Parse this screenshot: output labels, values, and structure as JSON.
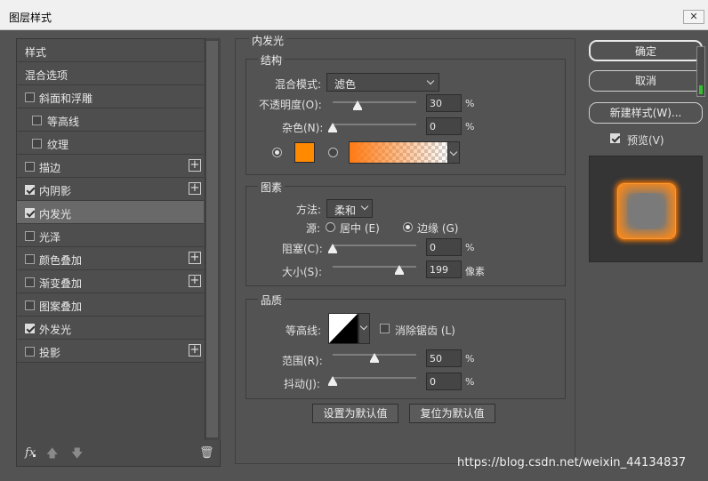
{
  "window": {
    "title": "图层样式",
    "close_glyph": "✕"
  },
  "left_list": {
    "items": [
      {
        "label": "样式",
        "checkbox": false,
        "checked": false,
        "plus": false,
        "selected": false
      },
      {
        "label": "混合选项",
        "checkbox": false,
        "checked": false,
        "plus": false,
        "selected": false
      },
      {
        "label": "斜面和浮雕",
        "checkbox": true,
        "checked": false,
        "plus": false,
        "selected": false
      },
      {
        "label": "等高线",
        "checkbox": true,
        "checked": false,
        "plus": false,
        "selected": false,
        "indent": true
      },
      {
        "label": "纹理",
        "checkbox": true,
        "checked": false,
        "plus": false,
        "selected": false,
        "indent": true
      },
      {
        "label": "描边",
        "checkbox": true,
        "checked": false,
        "plus": true,
        "selected": false
      },
      {
        "label": "内阴影",
        "checkbox": true,
        "checked": true,
        "plus": true,
        "selected": false
      },
      {
        "label": "内发光",
        "checkbox": true,
        "checked": true,
        "plus": false,
        "selected": true
      },
      {
        "label": "光泽",
        "checkbox": true,
        "checked": false,
        "plus": false,
        "selected": false
      },
      {
        "label": "颜色叠加",
        "checkbox": true,
        "checked": false,
        "plus": true,
        "selected": false
      },
      {
        "label": "渐变叠加",
        "checkbox": true,
        "checked": false,
        "plus": true,
        "selected": false
      },
      {
        "label": "图案叠加",
        "checkbox": true,
        "checked": false,
        "plus": false,
        "selected": false
      },
      {
        "label": "外发光",
        "checkbox": true,
        "checked": true,
        "plus": false,
        "selected": false
      },
      {
        "label": "投影",
        "checkbox": true,
        "checked": false,
        "plus": true,
        "selected": false
      }
    ],
    "footer": {
      "fx": "fx",
      "up_icon": "🡅",
      "down_icon": "🡇",
      "trash_icon": "🗑"
    }
  },
  "inner_glow": {
    "title": "内发光",
    "structure": {
      "title": "结构",
      "blend_mode_label": "混合模式:",
      "blend_mode_value": "滤色",
      "opacity_label": "不透明度(O):",
      "opacity_value": "30",
      "opacity_fraction": 0.3,
      "opacity_unit": "%",
      "noise_label": "杂色(N):",
      "noise_value": "0",
      "noise_fraction": 0.0,
      "noise_unit": "%",
      "color": "#ff8a00",
      "gradient_color": "#ff7a12"
    },
    "elements": {
      "title": "图素",
      "method_label": "方法:",
      "method_value": "柔和",
      "source_label": "源:",
      "source_center": "居中 (E)",
      "source_edge": "边缘 (G)",
      "choke_label": "阻塞(C):",
      "choke_value": "0",
      "choke_fraction": 0.0,
      "choke_unit": "%",
      "size_label": "大小(S):",
      "size_value": "199",
      "size_fraction": 0.8,
      "size_unit": "像素"
    },
    "quality": {
      "title": "品质",
      "contour_label": "等高线:",
      "anti_alias_label": "消除锯齿 (L)",
      "range_label": "范围(R):",
      "range_value": "50",
      "range_fraction": 0.5,
      "range_unit": "%",
      "jitter_label": "抖动(J):",
      "jitter_value": "0",
      "jitter_fraction": 0.0,
      "jitter_unit": "%"
    },
    "make_default": "设置为默认值",
    "reset_default": "复位为默认值"
  },
  "right": {
    "ok": "确定",
    "cancel": "取消",
    "new_style": "新建样式(W)...",
    "preview_label": "预览(V)",
    "preview_checked": true
  },
  "watermark": "https://blog.csdn.net/weixin_44134837"
}
